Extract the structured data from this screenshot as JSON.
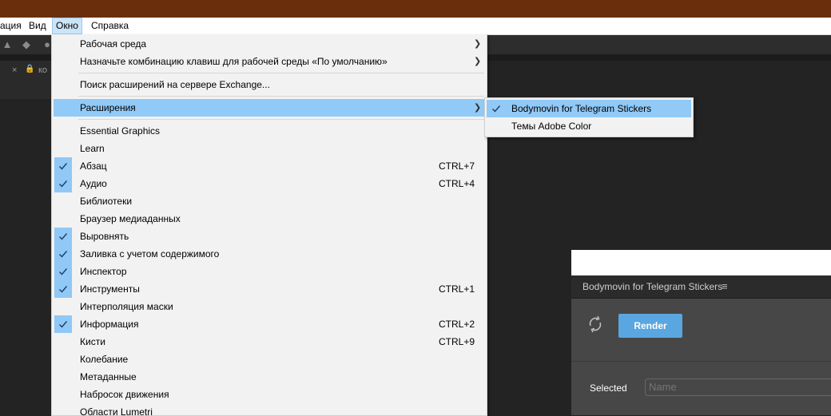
{
  "menubar": {
    "items": [
      {
        "label": "ация"
      },
      {
        "label": "Вид"
      },
      {
        "label": "Окно"
      },
      {
        "label": "Справка"
      }
    ]
  },
  "panel_left": {
    "close": "×",
    "tab_label": "ко"
  },
  "window_menu": {
    "items": [
      {
        "label": "Рабочая среда"
      },
      {
        "label": "Назначьте комбинацию клавиш для рабочей среды «По умолчанию»"
      },
      {
        "label": "Поиск расширений на сервере Exchange..."
      },
      {
        "label": "Расширения"
      },
      {
        "label": "Essential Graphics"
      },
      {
        "label": "Learn"
      },
      {
        "label": "Абзац",
        "shortcut": "CTRL+7"
      },
      {
        "label": "Аудио",
        "shortcut": "CTRL+4"
      },
      {
        "label": "Библиотеки"
      },
      {
        "label": "Браузер медиаданных"
      },
      {
        "label": "Выровнять"
      },
      {
        "label": "Заливка с учетом содержимого"
      },
      {
        "label": "Инспектор"
      },
      {
        "label": "Инструменты",
        "shortcut": "CTRL+1"
      },
      {
        "label": "Интерполяция маски"
      },
      {
        "label": "Информация",
        "shortcut": "CTRL+2"
      },
      {
        "label": "Кисти",
        "shortcut": "CTRL+9"
      },
      {
        "label": "Колебание"
      },
      {
        "label": "Метаданные"
      },
      {
        "label": "Набросок движения"
      },
      {
        "label": "Области Lumetri"
      }
    ]
  },
  "extensions_submenu": {
    "items": [
      {
        "label": "Bodymovin for Telegram Stickers"
      },
      {
        "label": "Темы Adobe Color"
      }
    ]
  },
  "bodymovin_panel": {
    "title": "Bodymovin for Telegram Stickers",
    "render_label": "Render",
    "selected_label": "Selected",
    "name_placeholder": "Name"
  },
  "colors": {
    "titlebar": "#6a2e0d",
    "menu_highlight": "#91c9f7",
    "render_button": "#5aa6e0"
  }
}
